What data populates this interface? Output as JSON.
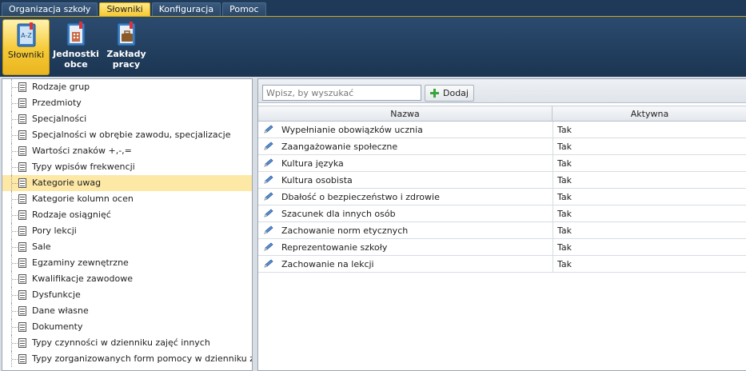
{
  "menu": {
    "tabs": [
      {
        "label": "Organizacja szkoły",
        "active": false
      },
      {
        "label": "Słowniki",
        "active": true
      },
      {
        "label": "Konfiguracja",
        "active": false
      },
      {
        "label": "Pomoc",
        "active": false
      }
    ]
  },
  "ribbon": {
    "buttons": [
      {
        "label": "Słowniki",
        "icon": "dictionary-az-icon",
        "active": true
      },
      {
        "label": "Jednostki obce",
        "line1": "Jednostki",
        "line2": "obce",
        "icon": "building-book-icon",
        "active": false
      },
      {
        "label": "Zakłady pracy",
        "line1": "Zakłady",
        "line2": "pracy",
        "icon": "briefcase-book-icon",
        "active": false
      }
    ]
  },
  "tree": {
    "items": [
      "Rodzaje grup",
      "Przedmioty",
      "Specjalności",
      "Specjalności w obrębie zawodu, specjalizacje",
      "Wartości znaków +,-,=",
      "Typy wpisów frekwencji",
      "Kategorie uwag",
      "Kategorie kolumn ocen",
      "Rodzaje osiągnięć",
      "Pory lekcji",
      "Sale",
      "Egzaminy zewnętrzne",
      "Kwalifikacje zawodowe",
      "Dysfunkcje",
      "Dane własne",
      "Dokumenty",
      "Typy czynności w dzienniku zajęć innych",
      "Typy zorganizowanych form pomocy w dzienniku zajęć in"
    ],
    "selected_index": 6
  },
  "toolbar": {
    "search_placeholder": "Wpisz, by wyszukać",
    "add_label": "Dodaj"
  },
  "grid": {
    "columns": [
      "Nazwa",
      "Aktywna"
    ],
    "rows": [
      {
        "nazwa": "Wypełnianie obowiązków ucznia",
        "aktywna": "Tak"
      },
      {
        "nazwa": "Zaangażowanie społeczne",
        "aktywna": "Tak"
      },
      {
        "nazwa": "Kultura języka",
        "aktywna": "Tak"
      },
      {
        "nazwa": "Kultura osobista",
        "aktywna": "Tak"
      },
      {
        "nazwa": "Dbałość o bezpieczeństwo i zdrowie",
        "aktywna": "Tak"
      },
      {
        "nazwa": "Szacunek dla innych osób",
        "aktywna": "Tak"
      },
      {
        "nazwa": "Zachowanie norm etycznych",
        "aktywna": "Tak"
      },
      {
        "nazwa": "Reprezentowanie szkoły",
        "aktywna": "Tak"
      },
      {
        "nazwa": "Zachowanie na lekcji",
        "aktywna": "Tak"
      }
    ]
  },
  "colors": {
    "header_bg": "#1e3a58",
    "active_tab": "#f5c935",
    "selected_row": "#fde8a6"
  }
}
